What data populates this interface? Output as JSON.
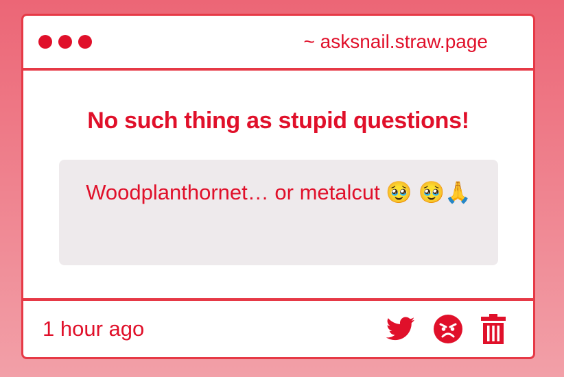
{
  "window": {
    "url": "~ asksnail.straw.page"
  },
  "main": {
    "headline": "No such thing as stupid questions!",
    "question_text": "Woodplanthornet… or metalcut 🥹 🥹🙏"
  },
  "footer": {
    "timestamp": "1 hour ago",
    "actions": [
      {
        "icon": "twitter-bird-icon"
      },
      {
        "icon": "angry-face-icon"
      },
      {
        "icon": "trash-icon"
      }
    ]
  },
  "colors": {
    "accent": "#e0102a",
    "border": "#e63946",
    "question_bg": "#eeeaec",
    "bg_top": "#ec6676",
    "bg_bottom": "#f2a0a8"
  }
}
